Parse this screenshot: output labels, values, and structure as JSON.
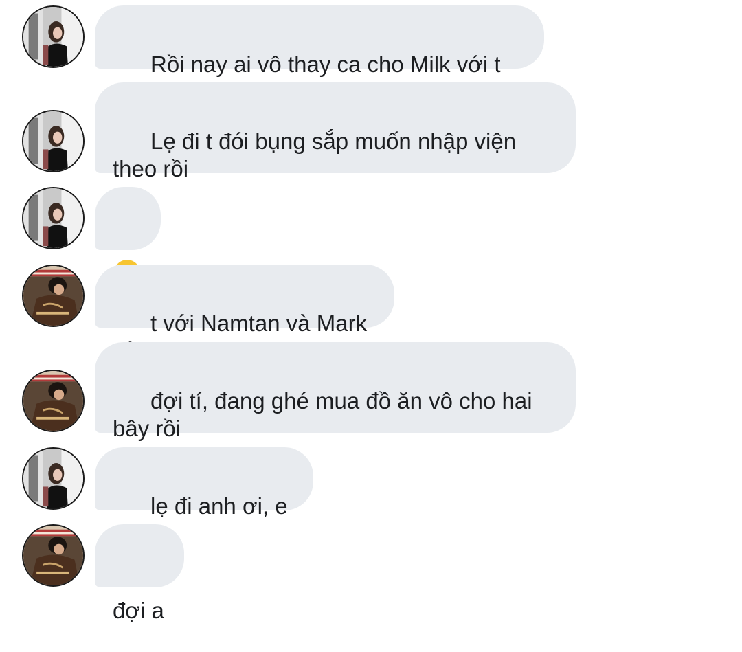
{
  "participants": {
    "girl": {
      "avatar_icon": "profile-photo-girl-black-dress"
    },
    "boy": {
      "avatar_icon": "profile-photo-boy-brown-jacket"
    }
  },
  "messages": [
    {
      "sender": "girl",
      "text": "Rồi nay ai vô thay ca cho Milk với t vậy"
    },
    {
      "sender": "girl",
      "text": "Lẹ đi t đói bụng sắp muốn nhập viện\ntheo rồi"
    },
    {
      "sender": "girl",
      "text": "",
      "emoji": "loudly-crying-face-emoji"
    },
    {
      "sender": "boy",
      "text": "t với Namtan và Mark nè"
    },
    {
      "sender": "boy",
      "text": "đợi tí, đang ghé mua đồ ăn vô cho hai\nbây rồi"
    },
    {
      "sender": "girl",
      "text": "lẹ đi anh ơi, e đói"
    },
    {
      "sender": "boy",
      "text": "đợi a"
    }
  ],
  "colors": {
    "bubble_background": "#e8ebef",
    "text": "#1c1e21"
  }
}
